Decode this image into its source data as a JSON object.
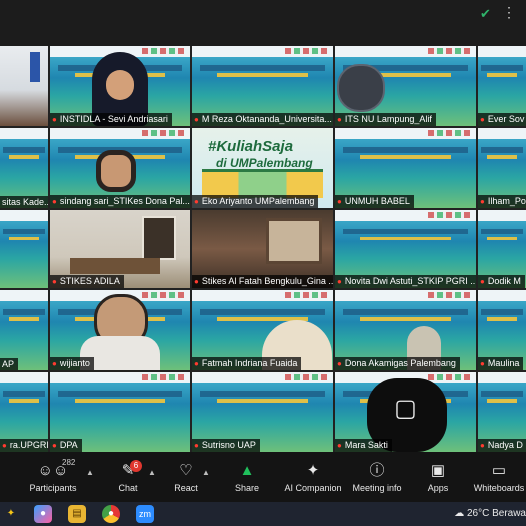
{
  "window": {
    "shield_icon": "shield-check-icon",
    "more_icon": "more-dots-icon"
  },
  "special_tile": {
    "hashtag": "#KuliahSaja",
    "subtitle": "di UMPalembang"
  },
  "participants": [
    {
      "name": "",
      "video": "room-projector"
    },
    {
      "name": "INSTIDLA - Sevi Andriasari",
      "video": "person"
    },
    {
      "name": "M Reza Oktananda_Universita...",
      "video": "slide"
    },
    {
      "name": "ITS NU Lampung_Alif",
      "video": "slide"
    },
    {
      "name": "Ever Sov",
      "video": "slide"
    },
    {
      "name": "sitas Kade...",
      "video": "slide"
    },
    {
      "name": "sindang sari_STIKes Dona Pal...",
      "video": "person-slide"
    },
    {
      "name": "Eko Ariyanto UMPalembang",
      "video": "special"
    },
    {
      "name": "UNMUH BABEL",
      "video": "slide"
    },
    {
      "name": "Ilham_Po",
      "video": "slide"
    },
    {
      "name": "",
      "video": "slide"
    },
    {
      "name": "STIKES ADILA",
      "video": "room"
    },
    {
      "name": "Stikes Al Fatah Bengkulu_Gina ...",
      "video": "room2"
    },
    {
      "name": "Novita Dwi Astuti_STKIP PGRI ...",
      "video": "slide"
    },
    {
      "name": "Dodik M",
      "video": "slide"
    },
    {
      "name": "AP",
      "video": "slide"
    },
    {
      "name": "wijianto",
      "video": "person-slide"
    },
    {
      "name": "Fatmah Indriana Fuaida",
      "video": "person-slide"
    },
    {
      "name": "Dona Akamigas Palembang",
      "video": "person-slide"
    },
    {
      "name": "Maulina",
      "video": "slide"
    },
    {
      "name": "ra.UPGRIP",
      "video": "slide"
    },
    {
      "name": "DPA",
      "video": "slide"
    },
    {
      "name": "Sutrisno UAP",
      "video": "slide"
    },
    {
      "name": "Mara Sakti",
      "video": "off"
    },
    {
      "name": "Nadya D",
      "video": "slide"
    }
  ],
  "toolbar": {
    "participants_label": "Participants",
    "participants_count": "282",
    "chat_label": "Chat",
    "chat_badge": "6",
    "react_label": "React",
    "share_label": "Share",
    "ai_label": "AI Companion",
    "info_label": "Meeting info",
    "apps_label": "Apps",
    "whiteboards_label": "Whiteboards"
  },
  "taskbar": {
    "weather_text": "26°C  Berawa",
    "zoom_label": "zm"
  },
  "colors": {
    "mic_muted": "#ff3b30",
    "share_green": "#20c05c",
    "chat_badge": "#e0372f"
  }
}
